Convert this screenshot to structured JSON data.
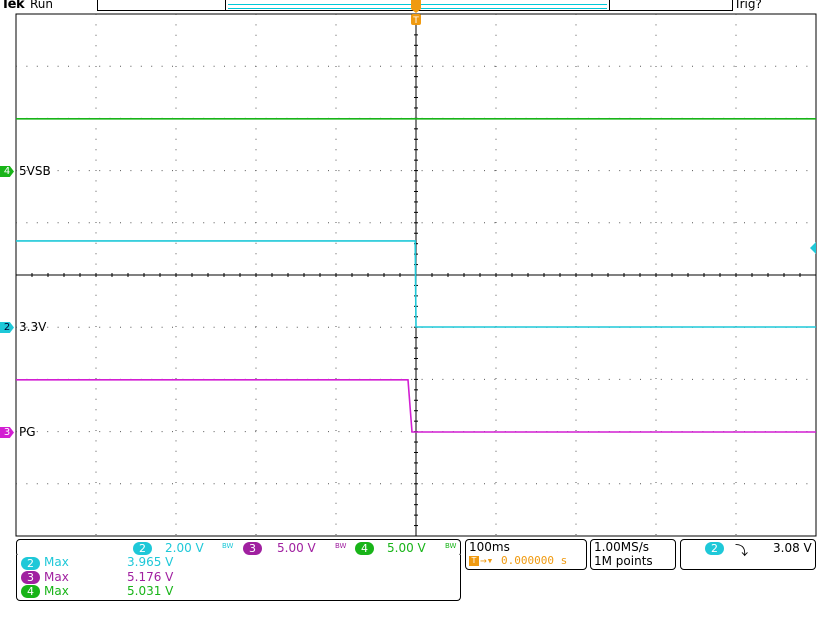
{
  "header": {
    "brand": "Tek",
    "run_state": "Run",
    "trigger_state": "Trig?",
    "trigger_marker": "T"
  },
  "channels": [
    {
      "id": "4",
      "label": "5VSB",
      "color": "#18b418",
      "scale": "5.00 V"
    },
    {
      "id": "2",
      "label": "3.3V",
      "color": "#1ec8d8",
      "scale": "2.00 V"
    },
    {
      "id": "3",
      "label": "PG",
      "color": "#d21ed2",
      "scale": "5.00 V"
    }
  ],
  "scale_bar": {
    "bw_symbol": "BW",
    "ch2": "2",
    "ch2_scale": "2.00 V",
    "ch3": "3",
    "ch3_scale": "5.00 V",
    "ch4": "4",
    "ch4_scale": "5.00 V"
  },
  "timebase": {
    "time_per_div": "100ms",
    "trigger_position": "0.000000 s",
    "sample_rate": "1.00MS/s",
    "record_length": "1M points"
  },
  "trigger_readout": {
    "channel": "2",
    "slope_symbol": "⤵",
    "level": "3.08 V"
  },
  "measurements": [
    {
      "channel": "2",
      "name": "Max",
      "value": "3.965 V",
      "color": "#1ec8d8"
    },
    {
      "channel": "3",
      "name": "Max",
      "value": "5.176 V",
      "color": "#a020a0"
    },
    {
      "channel": "4",
      "name": "Max",
      "value": "5.031 V",
      "color": "#18b418"
    }
  ],
  "chart_data": {
    "type": "line",
    "title": "",
    "x_unit": "s",
    "x_divisions": 10,
    "y_divisions": 10,
    "xlim": [
      -0.5,
      0.5
    ],
    "trigger_time": 0,
    "series": [
      {
        "name": "5VSB",
        "color": "#18b418",
        "volts_per_div": 5.0,
        "x": [
          -0.5,
          0.5
        ],
        "y": [
          5.0,
          5.0
        ]
      },
      {
        "name": "3.3V",
        "color": "#1ec8d8",
        "volts_per_div": 2.0,
        "x": [
          -0.5,
          -0.001,
          0.0,
          0.5
        ],
        "y": [
          3.3,
          3.3,
          0.0,
          0.0
        ]
      },
      {
        "name": "PG",
        "color": "#d21ed2",
        "volts_per_div": 5.0,
        "x": [
          -0.5,
          -0.01,
          -0.005,
          0.5
        ],
        "y": [
          5.0,
          5.0,
          0.0,
          0.0
        ]
      }
    ]
  }
}
